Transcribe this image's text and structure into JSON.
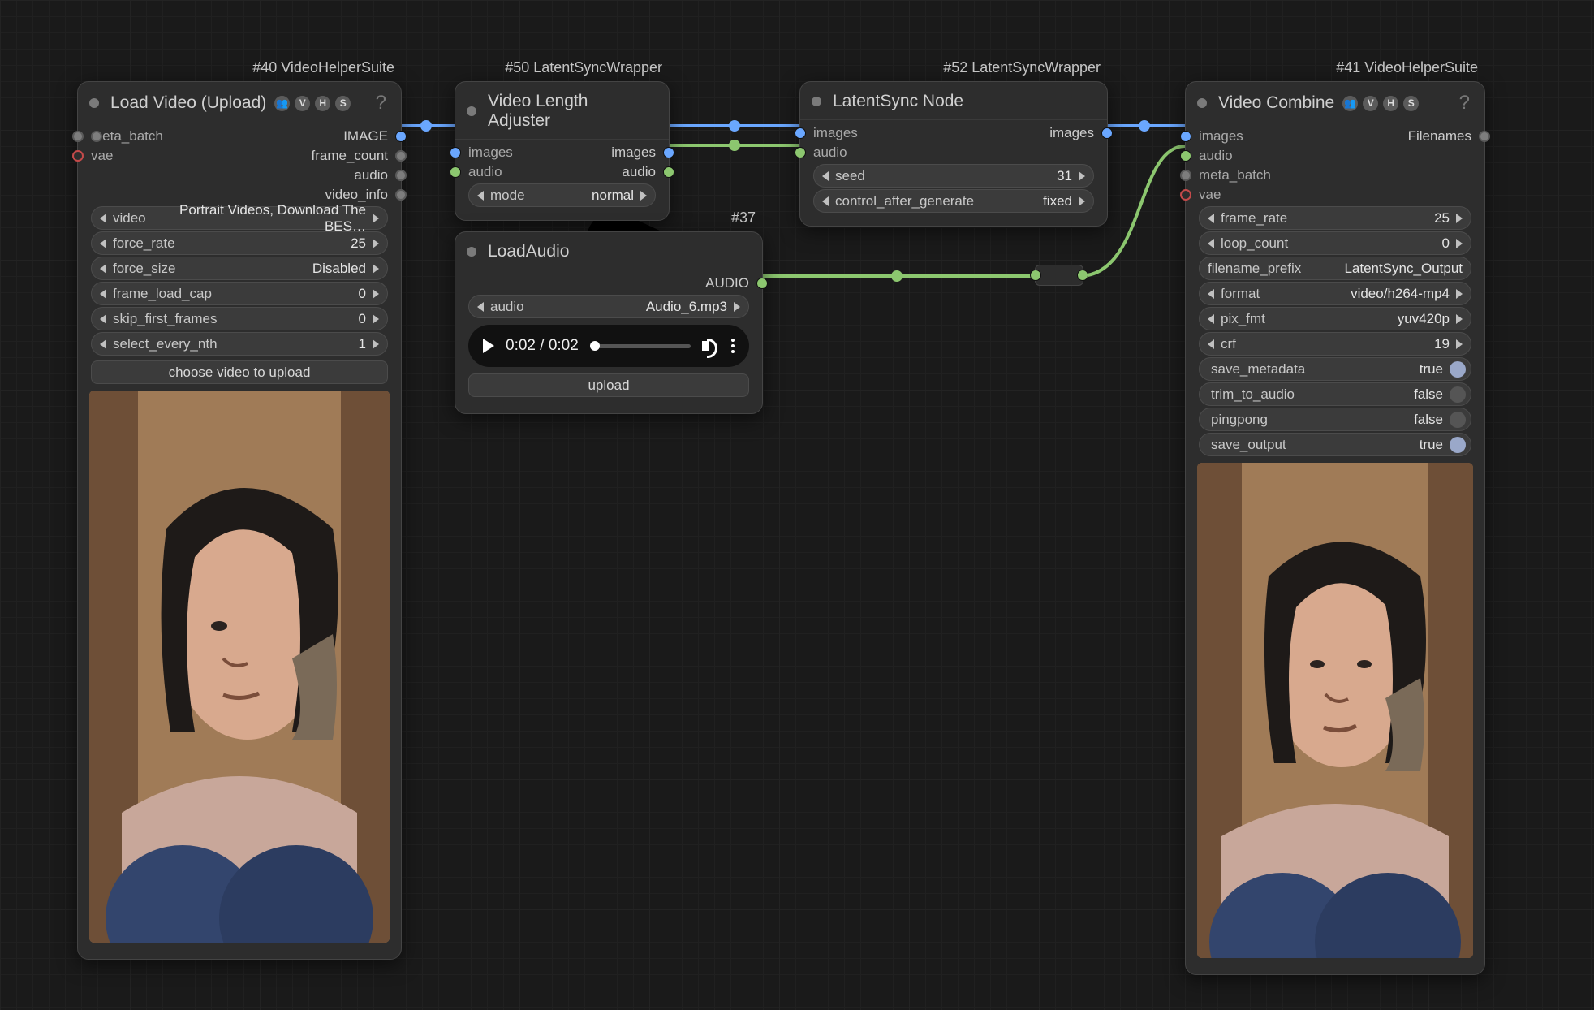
{
  "nodes": {
    "loadVideo": {
      "tag": "#40 VideoHelperSuite",
      "title": "Load Video (Upload)",
      "badges": [
        "👥",
        "V",
        "H",
        "S"
      ],
      "help": "?",
      "inputs": [
        "meta_batch",
        "vae"
      ],
      "outputs": [
        "IMAGE",
        "frame_count",
        "audio",
        "video_info"
      ],
      "widgets": {
        "video": {
          "label": "video",
          "value": "Portrait Videos, Download The BES…"
        },
        "force_rate": {
          "label": "force_rate",
          "value": "25"
        },
        "force_size": {
          "label": "force_size",
          "value": "Disabled"
        },
        "frame_load_cap": {
          "label": "frame_load_cap",
          "value": "0"
        },
        "skip_first_frames": {
          "label": "skip_first_frames",
          "value": "0"
        },
        "select_every_nth": {
          "label": "select_every_nth",
          "value": "1"
        }
      },
      "upload_btn": "choose video to upload"
    },
    "lenAdjust": {
      "tag": "#50 LatentSyncWrapper",
      "title": "Video Length Adjuster",
      "inputs": [
        "images",
        "audio"
      ],
      "outputs": [
        "images",
        "audio"
      ],
      "mode": {
        "label": "mode",
        "value": "normal"
      }
    },
    "loadAudio": {
      "tag": "#37",
      "title": "LoadAudio",
      "outputs": [
        "AUDIO"
      ],
      "audio": {
        "label": "audio",
        "value": "Audio_6.mp3"
      },
      "player_time": "0:02 / 0:02",
      "upload_btn": "upload"
    },
    "latentSync": {
      "tag": "#52 LatentSyncWrapper",
      "title": "LatentSync Node",
      "inputs": [
        "images",
        "audio"
      ],
      "outputs": [
        "images"
      ],
      "seed": {
        "label": "seed",
        "value": "31"
      },
      "cag": {
        "label": "control_after_generate",
        "value": "fixed"
      }
    },
    "videoCombine": {
      "tag": "#41 VideoHelperSuite",
      "title": "Video Combine",
      "badges": [
        "👥",
        "V",
        "H",
        "S"
      ],
      "help": "?",
      "inputs": [
        "images",
        "audio",
        "meta_batch",
        "vae"
      ],
      "outputs": [
        "Filenames"
      ],
      "widgets": {
        "frame_rate": {
          "label": "frame_rate",
          "value": "25"
        },
        "loop_count": {
          "label": "loop_count",
          "value": "0"
        },
        "filename_prefix": {
          "label": "filename_prefix",
          "value": "LatentSync_Output"
        },
        "format": {
          "label": "format",
          "value": "video/h264-mp4"
        },
        "pix_fmt": {
          "label": "pix_fmt",
          "value": "yuv420p"
        },
        "crf": {
          "label": "crf",
          "value": "19"
        }
      },
      "toggles": {
        "save_metadata": {
          "label": "save_metadata",
          "value": "true",
          "on": true
        },
        "trim_to_audio": {
          "label": "trim_to_audio",
          "value": "false",
          "on": false
        },
        "pingpong": {
          "label": "pingpong",
          "value": "false",
          "on": false
        },
        "save_output": {
          "label": "save_output",
          "value": "true",
          "on": true
        }
      }
    }
  },
  "colors": {
    "image_wire": "#6aa7ff",
    "audio_wire": "#8cc76f"
  }
}
